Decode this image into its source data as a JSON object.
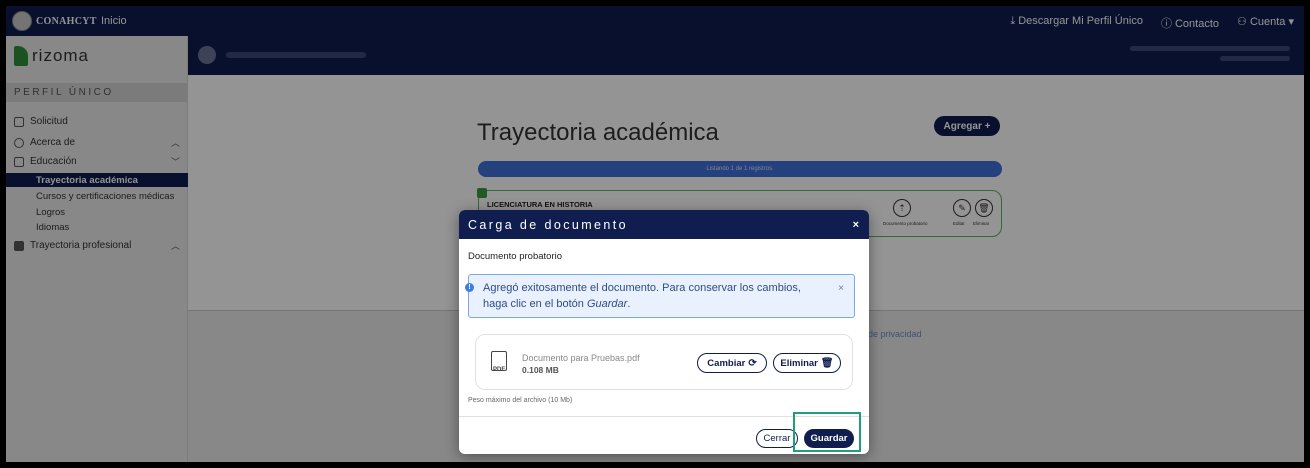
{
  "topbar": {
    "brand": "CONAHCYT",
    "inicio": "Inicio",
    "descargar": "⤓ Descargar Mi Perfil Único",
    "contacto": "ⓘ Contacto",
    "cuenta": "⚇ Cuenta ▾"
  },
  "sidebar": {
    "logo": "rizoma",
    "section": "PERFIL ÚNICO",
    "items": [
      {
        "label": "Solicitud",
        "icon": "document-icon",
        "chevron": ""
      },
      {
        "label": "Acerca de",
        "icon": "person-icon",
        "chevron": "︿"
      },
      {
        "label": "Educación",
        "icon": "book-icon",
        "chevron": "﹀"
      },
      {
        "label": "Trayectoria profesional",
        "icon": "briefcase-icon",
        "chevron": "︿"
      }
    ],
    "subitems": [
      "Trayectoria académica",
      "Cursos y certificaciones médicas",
      "Logros",
      "Idiomas"
    ]
  },
  "main": {
    "title": "Trayectoria académica",
    "agregar": "Agregar +",
    "listing": "Listando 1 de 1 registros.",
    "record_title": "LICENCIATURA EN HISTORIA",
    "actions": [
      "Documento probatorio",
      "Editar",
      "Eliminar"
    ],
    "privacy": "de privacidad"
  },
  "modal": {
    "title": "Carga de documento",
    "close": "×",
    "subtitle": "Documento probatorio",
    "alert_line1": "Agregó exitosamente el documento. Para conservar los cambios,",
    "alert_line2_prefix": "haga clic en el botón ",
    "alert_line2_em": "Guardar",
    "alert_line2_suffix": ".",
    "alert_close": "×",
    "file_name": "Documento para Pruebas.pdf",
    "file_size": "0.108 MB",
    "file_type": "PDF",
    "cambiar": "Cambiar",
    "eliminar": "Eliminar",
    "peso": "Peso máximo del archivo (10 Mb)",
    "cerrar": "Cerrar",
    "guardar": "Guardar"
  },
  "colors": {
    "navy": "#0f1d4f",
    "green": "#2d8e3a",
    "alert_blue": "#e8f1fd",
    "highlight": "#1e9e7a"
  }
}
